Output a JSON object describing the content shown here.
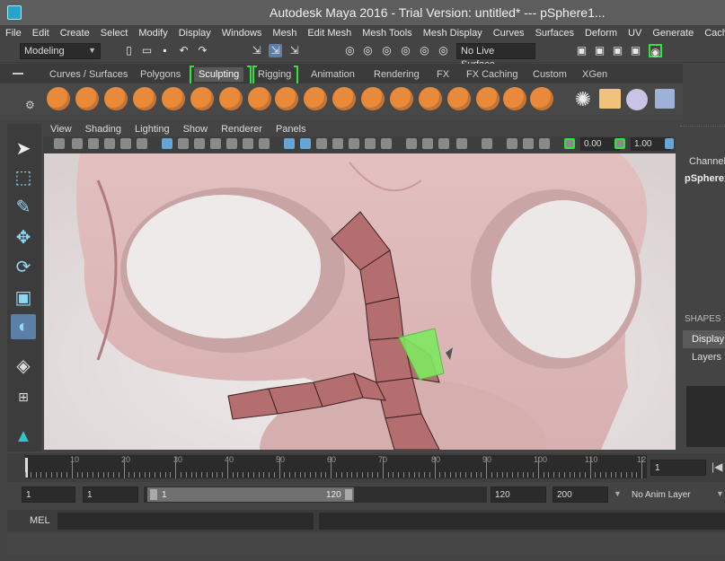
{
  "app": {
    "title": "Autodesk Maya 2016 - Trial Version: untitled*   ---   pSphere1..."
  },
  "menu": [
    "File",
    "Edit",
    "Create",
    "Select",
    "Modify",
    "Display",
    "Windows",
    "Mesh",
    "Edit Mesh",
    "Mesh Tools",
    "Mesh Display",
    "Curves",
    "Surfaces",
    "Deform",
    "UV",
    "Generate",
    "Cache"
  ],
  "statusline": {
    "mode": "Modeling",
    "live_surface": "No Live Surface"
  },
  "shelf_tabs": [
    "Curves / Surfaces",
    "Polygons",
    "Sculpting",
    "Rigging",
    "Animation",
    "Rendering",
    "FX",
    "FX Caching",
    "Custom",
    "XGen"
  ],
  "active_shelf_tab": "Sculpting",
  "viewport_menu": [
    "View",
    "Shading",
    "Lighting",
    "Show",
    "Renderer",
    "Panels"
  ],
  "viewport_values": {
    "value_a": "0.00",
    "value_b": "1.00"
  },
  "channel_box": {
    "label": "Channel",
    "object": "pSphere1",
    "shapes_label": "SHAPES"
  },
  "layer_editor": {
    "tab": "Display",
    "menu": "Layers"
  },
  "time_slider": {
    "ticks": [
      "10",
      "20",
      "30",
      "40",
      "50",
      "60",
      "70",
      "80",
      "90",
      "100",
      "110",
      "12"
    ],
    "current_frame": "1"
  },
  "range_slider": {
    "start": "1",
    "playback_start": "1",
    "range_start": "1",
    "range_end": "120",
    "playback_end": "120",
    "end": "200",
    "anim_layer": "No Anim Layer"
  },
  "command_line": {
    "label": "MEL"
  },
  "colors": {
    "accent": "#5b7fa6",
    "shelf_icon": "#e9893a",
    "highlight_bracket": "#32e43c",
    "selected_face": "#7fe860"
  }
}
